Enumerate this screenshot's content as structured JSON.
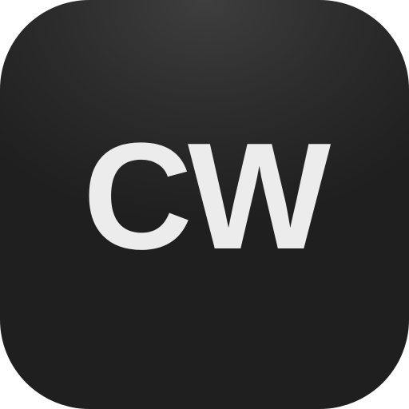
{
  "app_icon": {
    "label": "CW",
    "background_color": "#2b2b2b",
    "text_color": "#ececec"
  }
}
